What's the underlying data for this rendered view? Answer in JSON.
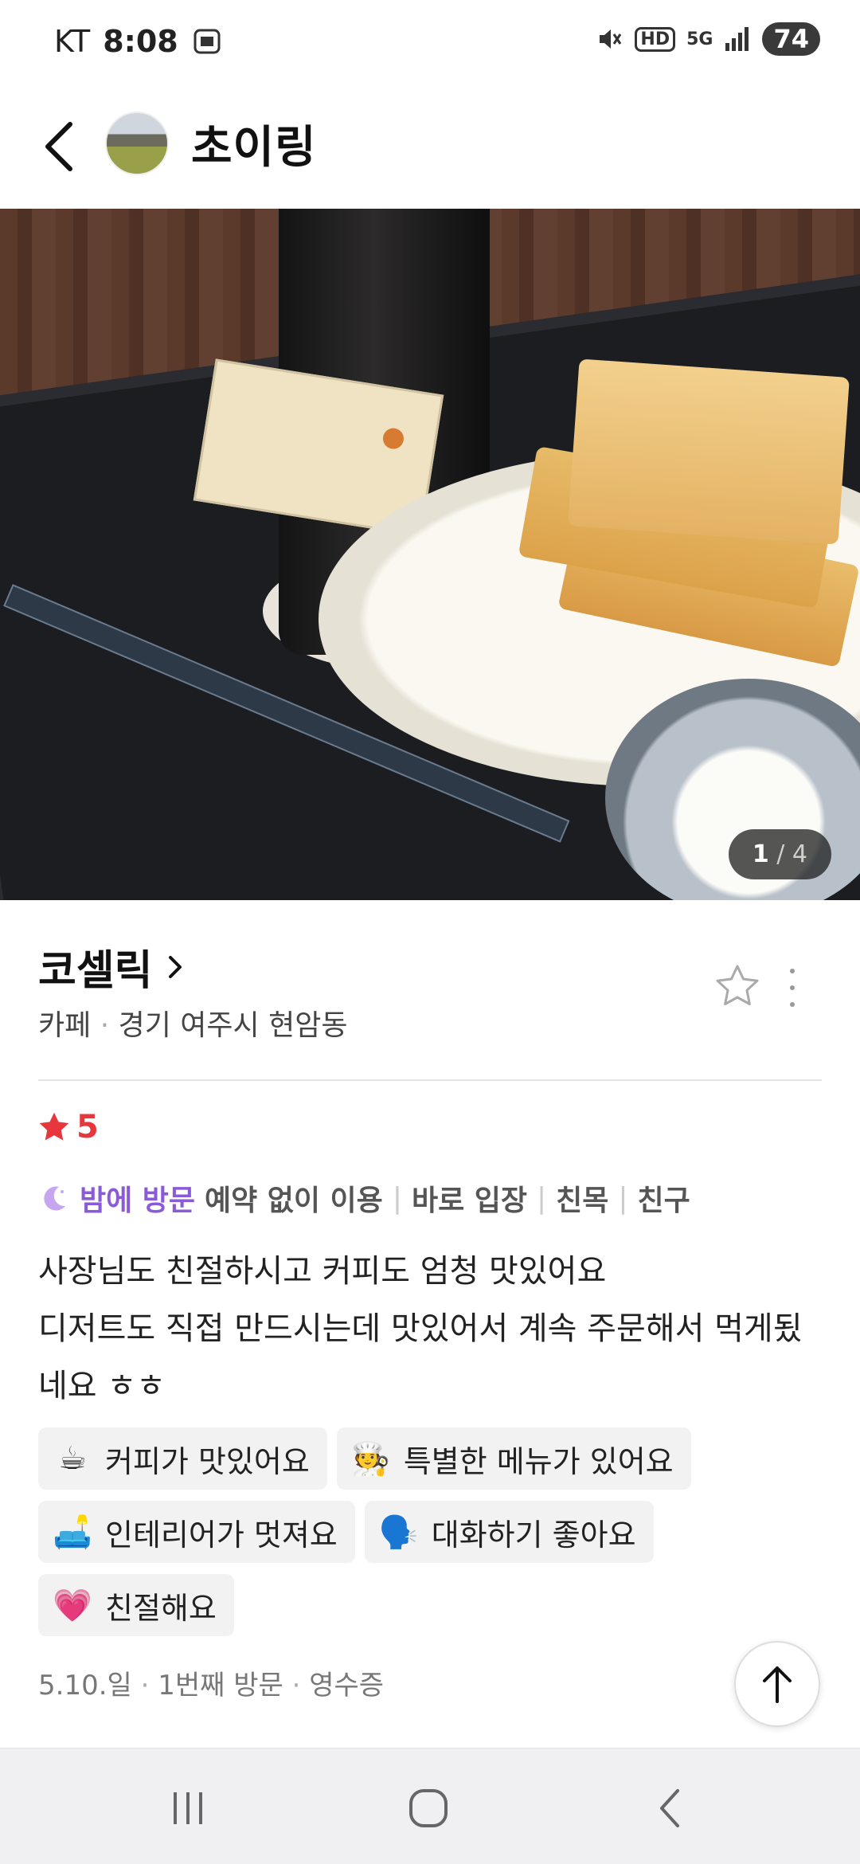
{
  "status_bar": {
    "carrier": "KT",
    "time": "8:08",
    "network_badge": "5G",
    "hd_badge": "HD",
    "battery": "74",
    "icons": [
      "screenshot-icon",
      "mute-icon",
      "signal-icon"
    ]
  },
  "header": {
    "profile_name": "초이링"
  },
  "photo": {
    "current": "1",
    "total": "/ 4"
  },
  "place": {
    "name": "코셀릭",
    "category": "카페",
    "location": "경기 여주시 현암동"
  },
  "review": {
    "rating": "5",
    "visit_time": "밤에 방문",
    "visit_tags": [
      "예약 없이 이용",
      "바로 입장",
      "친목",
      "친구"
    ],
    "text_line1": "사장님도 친절하시고 커피도 엄청 맛있어요",
    "text_line2": "디저트도 직접 만드시는데 맛있어서 계속 주문해서 먹게됬네요 ㅎㅎ",
    "keywords": [
      {
        "emoji": "☕",
        "label": "커피가 맛있어요"
      },
      {
        "emoji": "🧑‍🍳",
        "label": "특별한 메뉴가 있어요"
      },
      {
        "emoji": "🛋️",
        "label": "인테리어가 멋져요"
      },
      {
        "emoji": "🗣️",
        "label": "대화하기 좋아요"
      },
      {
        "emoji": "💗",
        "label": "친절해요"
      }
    ],
    "visit_date": "5.10.일",
    "visit_count": "1번째 방문",
    "verification": "영수증"
  },
  "colors": {
    "rating_red": "#e8363d",
    "night_purple": "#8a5bd6",
    "chip_bg": "#f2f2f2"
  }
}
